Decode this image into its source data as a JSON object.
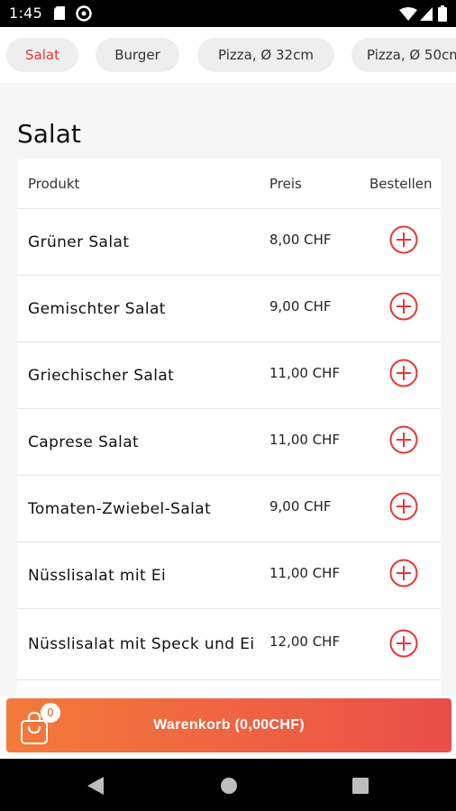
{
  "status_bar": {
    "time": "1:45",
    "icons": [
      "sd-card-icon",
      "sync-icon",
      "wifi-icon",
      "signal-icon",
      "battery-icon"
    ]
  },
  "categories": {
    "items": [
      {
        "label": "Salat",
        "active": true
      },
      {
        "label": "Burger",
        "active": false
      },
      {
        "label": "Pizza, Ø 32cm",
        "active": false
      },
      {
        "label": "Pizza, Ø 50cm",
        "active": false
      }
    ]
  },
  "section": {
    "title": "Salat"
  },
  "table": {
    "headers": {
      "product": "Produkt",
      "price": "Preis",
      "order": "Bestellen"
    },
    "rows": [
      {
        "name": "Grüner Salat",
        "price": "8,00 CHF"
      },
      {
        "name": "Gemischter Salat",
        "price": "9,00 CHF"
      },
      {
        "name": "Griechischer Salat",
        "price": "11,00 CHF"
      },
      {
        "name": "Caprese Salat",
        "price": "11,00 CHF"
      },
      {
        "name": "Tomaten-Zwiebel-Salat",
        "price": "9,00 CHF"
      },
      {
        "name": "Nüsslisalat mit Ei",
        "price": "11,00 CHF"
      },
      {
        "name": "Nüsslisalat mit Speck und Ei",
        "price": "12,00 CHF"
      }
    ],
    "add_icon": "plus-circle-icon"
  },
  "cart": {
    "label": "Warenkorb (0,00CHF)",
    "count": "0",
    "icon": "shopping-bag-icon"
  },
  "nav": {
    "icons": [
      "back-icon",
      "home-icon",
      "recents-icon"
    ]
  },
  "colors": {
    "accent": "#e53935",
    "cart_start": "#f47a3a",
    "cart_end": "#ea4e4a",
    "background": "#f6f6f7"
  }
}
